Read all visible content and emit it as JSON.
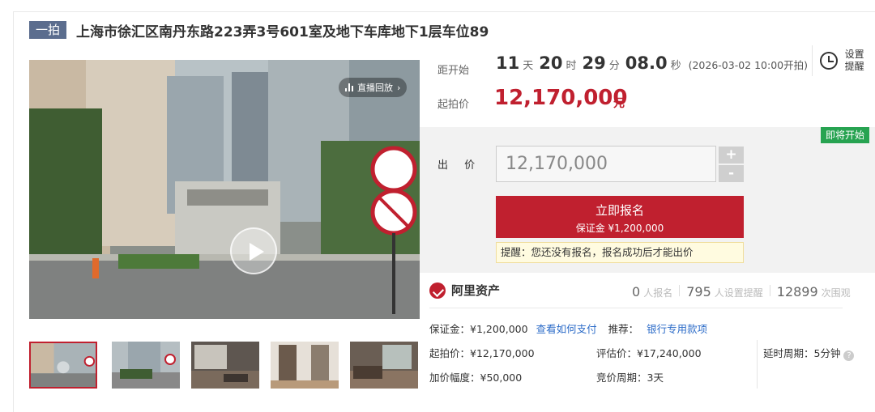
{
  "header": {
    "tag": "一拍",
    "title": "上海市徐汇区南丹东路223弄3号601室及地下车库地下1层车位89"
  },
  "media": {
    "replay_label": "直播回放",
    "thumbnail_count": 5
  },
  "countdown": {
    "label": "距开始",
    "days": "11",
    "days_unit": "天",
    "hours": "20",
    "hours_unit": "时",
    "minutes": "29",
    "minutes_unit": "分",
    "seconds": "08.0",
    "seconds_unit": "秒",
    "start_time": "(2026-03-02 10:00开拍)"
  },
  "start_price": {
    "label": "起拍价",
    "value": "12,170,000",
    "unit": "元"
  },
  "reminder": {
    "label_line1": "设置",
    "label_line2": "提醒"
  },
  "bid": {
    "status_badge": "即将开始",
    "label": "出 价",
    "value": "12,170,000",
    "plus": "+",
    "minus": "-",
    "signup_label": "立即报名",
    "signup_deposit": "保证金 ¥1,200,000",
    "tip": "提醒：您还没有报名，报名成功后才能出价"
  },
  "colors": {
    "accent": "#c0202f",
    "badge_green": "#27a351",
    "link": "#2b6bc8",
    "tag_bg": "#5b6d8e"
  },
  "platform": {
    "name": "阿里资产",
    "stats": [
      {
        "value": "0",
        "label": "人报名"
      },
      {
        "value": "795",
        "label": "人设置提醒"
      },
      {
        "value": "12899",
        "label": "次围观"
      }
    ]
  },
  "details": {
    "deposit_label": "保证金：¥1,200,000",
    "how_to_pay": "查看如何支付",
    "recommend_label": "推荐：",
    "bank_payment": "银行专用款项",
    "start_price": "起拍价：¥12,170,000",
    "valuation": "评估价：¥17,240,000",
    "delay_period": "延时周期：5分钟",
    "increment": "加价幅度：¥50,000",
    "bid_period": "竞价周期：3天",
    "help_icon": "?"
  }
}
